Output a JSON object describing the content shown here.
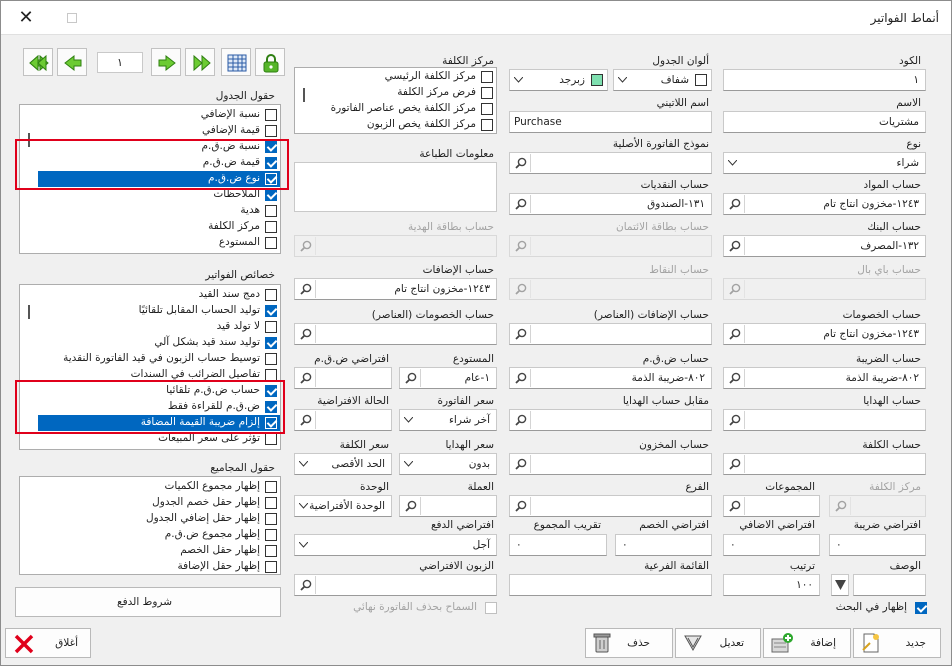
{
  "window": {
    "title": "أنماط الفواتير"
  },
  "nav": {
    "page_number": "١"
  },
  "left": {
    "table_fields_title": "حقول الجدول",
    "table_fields": [
      {
        "label": "نسبة الإضافي",
        "checked": false
      },
      {
        "label": "قيمة الإضافي",
        "checked": false
      },
      {
        "label": "نسبة ض.ق.م",
        "checked": true
      },
      {
        "label": "قيمة ض.ق.م",
        "checked": true
      },
      {
        "label": "نوع ض.ق.م",
        "checked": true,
        "selected": true
      },
      {
        "label": "الملاحظات",
        "checked": true
      },
      {
        "label": "هدية",
        "checked": false
      },
      {
        "label": "مركز الكلفة",
        "checked": false
      },
      {
        "label": "المستودع",
        "checked": false
      }
    ],
    "invoice_props_title": "خصائص الفواتير",
    "invoice_props": [
      {
        "label": "دمج سند القيد",
        "checked": false
      },
      {
        "label": "توليد الحساب المقابل تلقائيًا",
        "checked": true
      },
      {
        "label": "لا تولد قيد",
        "checked": false
      },
      {
        "label": "توليد سند قيد بشكل آلي",
        "checked": true
      },
      {
        "label": "توسيط حساب الزبون في قيد الفاتورة النقدية",
        "checked": false
      },
      {
        "label": "تفاصيل الضرائب في السندات",
        "checked": false
      },
      {
        "label": "حساب ض.ق.م تلقائيا",
        "checked": true
      },
      {
        "label": "ض.ق.م للقراءة فقط",
        "checked": true
      },
      {
        "label": "إلزام ضريبة القيمة المضافة",
        "checked": true,
        "selected": true
      },
      {
        "label": "تؤثر على سعر المبيعات",
        "checked": false
      }
    ],
    "totals_title": "حقول المجاميع",
    "totals_fields": [
      {
        "label": "إظهار مجموع الكميات",
        "checked": false
      },
      {
        "label": "إظهار حقل خصم الجدول",
        "checked": false
      },
      {
        "label": "إظهار حقل إضافي الجدول",
        "checked": false
      },
      {
        "label": "إظهار مجموع ض.ق.م",
        "checked": false
      },
      {
        "label": "إظهار حقل الخصم",
        "checked": false
      },
      {
        "label": "إظهار حقل الإضافة",
        "checked": false
      }
    ],
    "payment_terms_button": "شروط الدفع"
  },
  "form": {
    "code_label": "الكود",
    "code_value": "١",
    "name_label": "الاسم",
    "name_value": "مشتريات",
    "type_label": "نوع",
    "type_value": "شراء",
    "materials_label": "حساب المواد",
    "materials_value": "١٢٤٣-مخزون انتاج تام",
    "bank_label": "حساب البنك",
    "bank_value": "١٣٢-المصرف",
    "paypal_label": "حساب باي بال",
    "discounts_label": "حساب الخصومات",
    "discounts_value": "١٢٤٣-مخزون انتاج تام",
    "tax_label": "حساب الضريبة",
    "tax_value": "٨٠٢-ضريبة الذمة",
    "gifts_label": "حساب الهدايا",
    "cost_label": "حساب الكلفة",
    "cost_center_label": "مركز الكلفة",
    "tax_default_label": "افتراضي ضريبة",
    "tax_default_value": "٠",
    "desc_label": "الوصف",
    "show_search_label": "إظهار في البحث",
    "show_search_checked": true,
    "table_colors_label": "ألوان الجدول",
    "color1_value": "شفاف",
    "color1_hex": "#ffffff",
    "color2_value": "زبرجد",
    "color2_hex": "#7fe0b0",
    "latin_name_label": "اسم اللاتيني",
    "latin_name_value": "Purchase",
    "original_form_label": "نموذج الفاتورة الأصلية",
    "cash_label": "حساب النقديات",
    "cash_value": "١٣١-الصندوق",
    "credit_card_label": "حساب بطاقة الائتمان",
    "points_label": "حساب النقاط",
    "additions_items_label": "حساب الإضافات (العناصر)",
    "vat_account_label": "حساب ض.ق.م",
    "vat_account_value": "٨٠٢-ضريبة الذمة",
    "gifts_offset_label": "مقابل حساب الهدايا",
    "stock_account_label": "حساب المخزون",
    "groups_label": "المجموعات",
    "branch_label": "الفرع",
    "additional_default_label": "افتراضي الاضافي",
    "additional_default_value": "٠",
    "discount_default_label": "افتراضي الخصم",
    "discount_default_value": "٠",
    "round_total_label": "تقريب المجموع",
    "round_total_value": "٠",
    "sort_label": "ترتيب",
    "sort_value": "١٠٠",
    "sub_list_label": "القائمة الفرعية",
    "cost_centers_label": "مركز الكلفة",
    "cost_centers": [
      {
        "label": "مركز الكلفة الرئيسي",
        "checked": false
      },
      {
        "label": "فرض مركز الكلفة",
        "checked": false
      },
      {
        "label": "مركز الكلفة يخص عناصر الفاتورة",
        "checked": false
      },
      {
        "label": "مركز الكلفة يخص الزبون",
        "checked": false
      }
    ],
    "print_info_label": "معلومات الطباعة",
    "gift_card_label": "حساب بطاقة الهدية",
    "additions_label": "حساب الإضافات",
    "additions_value": "١٢٤٣-مخزون انتاج تام",
    "discounts_items_label": "حساب الخصومات (العناصر)",
    "warehouse_label": "المستودع",
    "warehouse_value": "١-عام",
    "vat_default_label": "افتراضي ض.ق.م",
    "invoice_price_label": "سعر الفاتورة",
    "invoice_price_value": "آخر شراء",
    "default_state_label": "الحالة الافتراضية",
    "gifts_price_label": "سعر الهدايا",
    "gifts_price_value": "بدون",
    "cost_price_label": "سعر الكلفة",
    "cost_price_value": "الحد الأقصى",
    "currency_label": "العملة",
    "unit_label": "الوحدة",
    "unit_value": "الوحدة الأفتراضية",
    "payment_default_label": "افتراضي الدفع",
    "payment_default_value": "آجل",
    "default_customer_label": "الزبون الافتراضي",
    "allow_delete_label": "السماح بحذف الفاتورة نهائي"
  },
  "buttons": {
    "new": "جديد",
    "add": "إضافة",
    "edit": "تعديل",
    "delete": "حذف",
    "close": "أغلاق"
  }
}
